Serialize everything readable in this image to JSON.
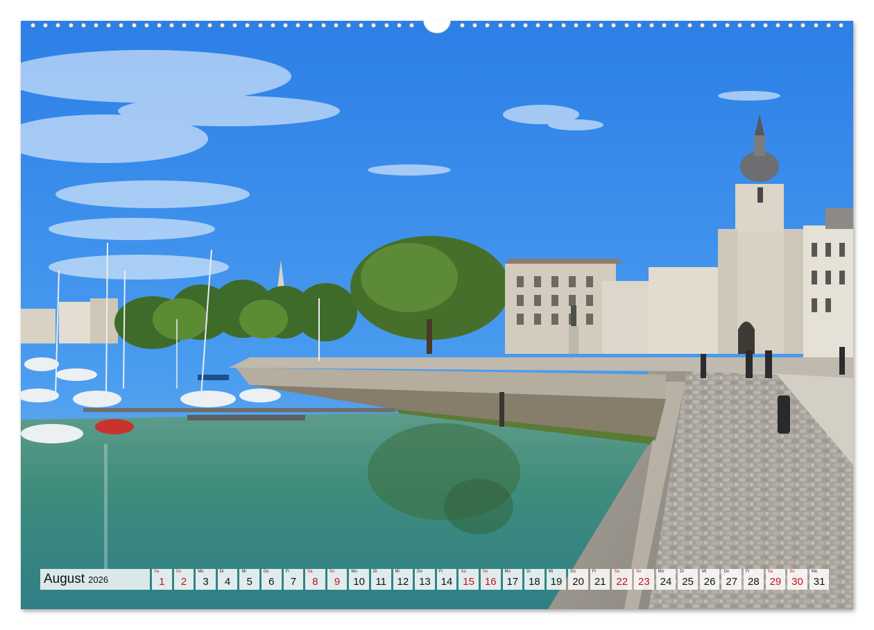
{
  "calendar": {
    "month": "August",
    "year": "2026",
    "days": [
      {
        "dow": "Sa",
        "num": "1",
        "weekend": true
      },
      {
        "dow": "So",
        "num": "2",
        "weekend": true
      },
      {
        "dow": "Mo",
        "num": "3",
        "weekend": false
      },
      {
        "dow": "Di",
        "num": "4",
        "weekend": false
      },
      {
        "dow": "Mi",
        "num": "5",
        "weekend": false
      },
      {
        "dow": "Do",
        "num": "6",
        "weekend": false
      },
      {
        "dow": "Fr",
        "num": "7",
        "weekend": false
      },
      {
        "dow": "Sa",
        "num": "8",
        "weekend": true
      },
      {
        "dow": "So",
        "num": "9",
        "weekend": true
      },
      {
        "dow": "Mo",
        "num": "10",
        "weekend": false
      },
      {
        "dow": "Di",
        "num": "11",
        "weekend": false
      },
      {
        "dow": "Mi",
        "num": "12",
        "weekend": false
      },
      {
        "dow": "Do",
        "num": "13",
        "weekend": false
      },
      {
        "dow": "Fr",
        "num": "14",
        "weekend": false
      },
      {
        "dow": "Sa",
        "num": "15",
        "weekend": true
      },
      {
        "dow": "So",
        "num": "16",
        "weekend": true
      },
      {
        "dow": "Mo",
        "num": "17",
        "weekend": false
      },
      {
        "dow": "Di",
        "num": "18",
        "weekend": false
      },
      {
        "dow": "Mi",
        "num": "19",
        "weekend": false
      },
      {
        "dow": "Do",
        "num": "20",
        "weekend": false
      },
      {
        "dow": "Fr",
        "num": "21",
        "weekend": false
      },
      {
        "dow": "Sa",
        "num": "22",
        "weekend": true
      },
      {
        "dow": "So",
        "num": "23",
        "weekend": true
      },
      {
        "dow": "Mo",
        "num": "24",
        "weekend": false
      },
      {
        "dow": "Di",
        "num": "25",
        "weekend": false
      },
      {
        "dow": "Mi",
        "num": "26",
        "weekend": false
      },
      {
        "dow": "Do",
        "num": "27",
        "weekend": false
      },
      {
        "dow": "Fr",
        "num": "28",
        "weekend": false
      },
      {
        "dow": "Sa",
        "num": "29",
        "weekend": true
      },
      {
        "dow": "So",
        "num": "30",
        "weekend": true
      },
      {
        "dow": "Mo",
        "num": "31",
        "weekend": false
      }
    ]
  },
  "colors": {
    "weekend": "#c4121a",
    "weekday": "#111111",
    "sky": "#3a8de8",
    "water": "#3f8f7f"
  }
}
